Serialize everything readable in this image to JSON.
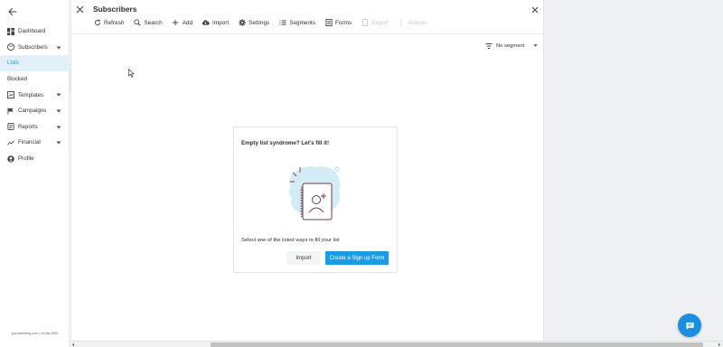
{
  "sidebar": {
    "items": [
      {
        "label": "Dashboard",
        "icon": "dashboard-icon"
      },
      {
        "label": "Subscribers",
        "icon": "subscribers-icon",
        "expandable": true
      },
      {
        "label": "Lists",
        "active": true
      },
      {
        "label": "Blocked"
      },
      {
        "label": "Templates",
        "icon": "templates-icon",
        "expandable": true
      },
      {
        "label": "Campaigns",
        "icon": "campaigns-icon",
        "expandable": true
      },
      {
        "label": "Reports",
        "icon": "reports-icon",
        "expandable": true
      },
      {
        "label": "Financial",
        "icon": "financial-icon",
        "expandable": true
      },
      {
        "label": "Profile",
        "icon": "profile-icon"
      }
    ],
    "version": "ipzmarketing.com | v3.8a.2050"
  },
  "panel": {
    "title": "Subscribers",
    "toolbar": {
      "refresh": "Refresh",
      "search": "Search",
      "add": "Add",
      "import": "Import",
      "settings": "Settings",
      "segments": "Segments",
      "forms": "Forms",
      "export": "Export",
      "actions": "Actions"
    },
    "segment_select": "No segment"
  },
  "empty_card": {
    "title": "Empty list syndrome? Let's fill it!",
    "text": "Select one of the listed ways to fill your list",
    "import_label": "Import",
    "create_label": "Create a Sign up Form"
  },
  "colors": {
    "accent": "#1a9be6",
    "active_nav": "#e1f0f9",
    "chat": "#1a8fdf"
  }
}
